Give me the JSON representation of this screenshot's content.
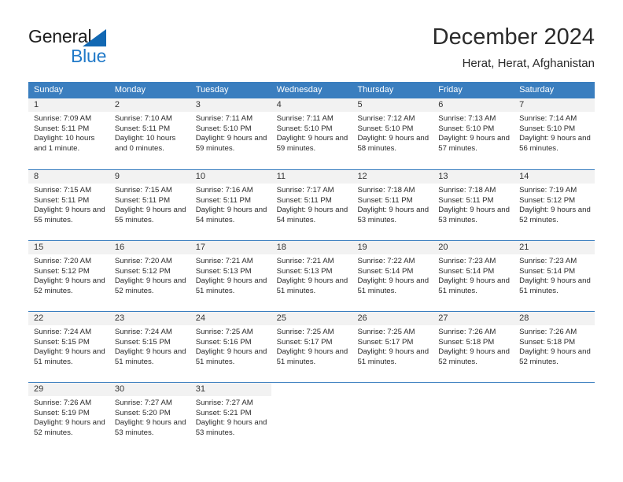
{
  "brand": {
    "name_part1": "General",
    "name_part2": "Blue",
    "accent_color": "#2079c8",
    "triangle_color": "#1268b3"
  },
  "header": {
    "title": "December 2024",
    "subtitle": "Herat, Herat, Afghanistan"
  },
  "calendar": {
    "header_bg": "#3a7ebf",
    "daynum_bg": "#f2f2f2",
    "day_names": [
      "Sunday",
      "Monday",
      "Tuesday",
      "Wednesday",
      "Thursday",
      "Friday",
      "Saturday"
    ],
    "weeks": [
      [
        {
          "day": "1",
          "sunrise": "Sunrise: 7:09 AM",
          "sunset": "Sunset: 5:11 PM",
          "daylight": "Daylight: 10 hours and 1 minute."
        },
        {
          "day": "2",
          "sunrise": "Sunrise: 7:10 AM",
          "sunset": "Sunset: 5:11 PM",
          "daylight": "Daylight: 10 hours and 0 minutes."
        },
        {
          "day": "3",
          "sunrise": "Sunrise: 7:11 AM",
          "sunset": "Sunset: 5:10 PM",
          "daylight": "Daylight: 9 hours and 59 minutes."
        },
        {
          "day": "4",
          "sunrise": "Sunrise: 7:11 AM",
          "sunset": "Sunset: 5:10 PM",
          "daylight": "Daylight: 9 hours and 59 minutes."
        },
        {
          "day": "5",
          "sunrise": "Sunrise: 7:12 AM",
          "sunset": "Sunset: 5:10 PM",
          "daylight": "Daylight: 9 hours and 58 minutes."
        },
        {
          "day": "6",
          "sunrise": "Sunrise: 7:13 AM",
          "sunset": "Sunset: 5:10 PM",
          "daylight": "Daylight: 9 hours and 57 minutes."
        },
        {
          "day": "7",
          "sunrise": "Sunrise: 7:14 AM",
          "sunset": "Sunset: 5:10 PM",
          "daylight": "Daylight: 9 hours and 56 minutes."
        }
      ],
      [
        {
          "day": "8",
          "sunrise": "Sunrise: 7:15 AM",
          "sunset": "Sunset: 5:11 PM",
          "daylight": "Daylight: 9 hours and 55 minutes."
        },
        {
          "day": "9",
          "sunrise": "Sunrise: 7:15 AM",
          "sunset": "Sunset: 5:11 PM",
          "daylight": "Daylight: 9 hours and 55 minutes."
        },
        {
          "day": "10",
          "sunrise": "Sunrise: 7:16 AM",
          "sunset": "Sunset: 5:11 PM",
          "daylight": "Daylight: 9 hours and 54 minutes."
        },
        {
          "day": "11",
          "sunrise": "Sunrise: 7:17 AM",
          "sunset": "Sunset: 5:11 PM",
          "daylight": "Daylight: 9 hours and 54 minutes."
        },
        {
          "day": "12",
          "sunrise": "Sunrise: 7:18 AM",
          "sunset": "Sunset: 5:11 PM",
          "daylight": "Daylight: 9 hours and 53 minutes."
        },
        {
          "day": "13",
          "sunrise": "Sunrise: 7:18 AM",
          "sunset": "Sunset: 5:11 PM",
          "daylight": "Daylight: 9 hours and 53 minutes."
        },
        {
          "day": "14",
          "sunrise": "Sunrise: 7:19 AM",
          "sunset": "Sunset: 5:12 PM",
          "daylight": "Daylight: 9 hours and 52 minutes."
        }
      ],
      [
        {
          "day": "15",
          "sunrise": "Sunrise: 7:20 AM",
          "sunset": "Sunset: 5:12 PM",
          "daylight": "Daylight: 9 hours and 52 minutes."
        },
        {
          "day": "16",
          "sunrise": "Sunrise: 7:20 AM",
          "sunset": "Sunset: 5:12 PM",
          "daylight": "Daylight: 9 hours and 52 minutes."
        },
        {
          "day": "17",
          "sunrise": "Sunrise: 7:21 AM",
          "sunset": "Sunset: 5:13 PM",
          "daylight": "Daylight: 9 hours and 51 minutes."
        },
        {
          "day": "18",
          "sunrise": "Sunrise: 7:21 AM",
          "sunset": "Sunset: 5:13 PM",
          "daylight": "Daylight: 9 hours and 51 minutes."
        },
        {
          "day": "19",
          "sunrise": "Sunrise: 7:22 AM",
          "sunset": "Sunset: 5:14 PM",
          "daylight": "Daylight: 9 hours and 51 minutes."
        },
        {
          "day": "20",
          "sunrise": "Sunrise: 7:23 AM",
          "sunset": "Sunset: 5:14 PM",
          "daylight": "Daylight: 9 hours and 51 minutes."
        },
        {
          "day": "21",
          "sunrise": "Sunrise: 7:23 AM",
          "sunset": "Sunset: 5:14 PM",
          "daylight": "Daylight: 9 hours and 51 minutes."
        }
      ],
      [
        {
          "day": "22",
          "sunrise": "Sunrise: 7:24 AM",
          "sunset": "Sunset: 5:15 PM",
          "daylight": "Daylight: 9 hours and 51 minutes."
        },
        {
          "day": "23",
          "sunrise": "Sunrise: 7:24 AM",
          "sunset": "Sunset: 5:15 PM",
          "daylight": "Daylight: 9 hours and 51 minutes."
        },
        {
          "day": "24",
          "sunrise": "Sunrise: 7:25 AM",
          "sunset": "Sunset: 5:16 PM",
          "daylight": "Daylight: 9 hours and 51 minutes."
        },
        {
          "day": "25",
          "sunrise": "Sunrise: 7:25 AM",
          "sunset": "Sunset: 5:17 PM",
          "daylight": "Daylight: 9 hours and 51 minutes."
        },
        {
          "day": "26",
          "sunrise": "Sunrise: 7:25 AM",
          "sunset": "Sunset: 5:17 PM",
          "daylight": "Daylight: 9 hours and 51 minutes."
        },
        {
          "day": "27",
          "sunrise": "Sunrise: 7:26 AM",
          "sunset": "Sunset: 5:18 PM",
          "daylight": "Daylight: 9 hours and 52 minutes."
        },
        {
          "day": "28",
          "sunrise": "Sunrise: 7:26 AM",
          "sunset": "Sunset: 5:18 PM",
          "daylight": "Daylight: 9 hours and 52 minutes."
        }
      ],
      [
        {
          "day": "29",
          "sunrise": "Sunrise: 7:26 AM",
          "sunset": "Sunset: 5:19 PM",
          "daylight": "Daylight: 9 hours and 52 minutes."
        },
        {
          "day": "30",
          "sunrise": "Sunrise: 7:27 AM",
          "sunset": "Sunset: 5:20 PM",
          "daylight": "Daylight: 9 hours and 53 minutes."
        },
        {
          "day": "31",
          "sunrise": "Sunrise: 7:27 AM",
          "sunset": "Sunset: 5:21 PM",
          "daylight": "Daylight: 9 hours and 53 minutes."
        },
        {
          "day": "",
          "sunrise": "",
          "sunset": "",
          "daylight": ""
        },
        {
          "day": "",
          "sunrise": "",
          "sunset": "",
          "daylight": ""
        },
        {
          "day": "",
          "sunrise": "",
          "sunset": "",
          "daylight": ""
        },
        {
          "day": "",
          "sunrise": "",
          "sunset": "",
          "daylight": ""
        }
      ]
    ]
  }
}
